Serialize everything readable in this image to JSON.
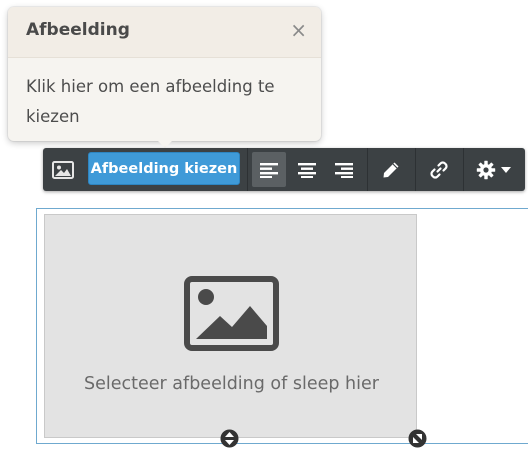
{
  "popover": {
    "title": "Afbeelding",
    "close": "×",
    "body": "Klik hier om een afbeelding te kiezen"
  },
  "toolbar": {
    "image_icon": "image-icon",
    "choose_label": "Afbeelding kiezen",
    "align_buttons": [
      "align-left-icon",
      "align-center-icon",
      "align-right-icon"
    ],
    "active_align": "align-left-icon",
    "edit_icon": "pencil-icon",
    "link_icon": "link-icon",
    "settings_icon": "gear-icon"
  },
  "placeholder": {
    "icon": "image-icon",
    "text": "Selecteer afbeelding of sleep hier"
  },
  "colors": {
    "toolbar_bg": "#3c4144",
    "primary_button": "#3f9ad8",
    "frame_border": "#6fa9cf",
    "placeholder_bg": "#e3e3e3"
  }
}
